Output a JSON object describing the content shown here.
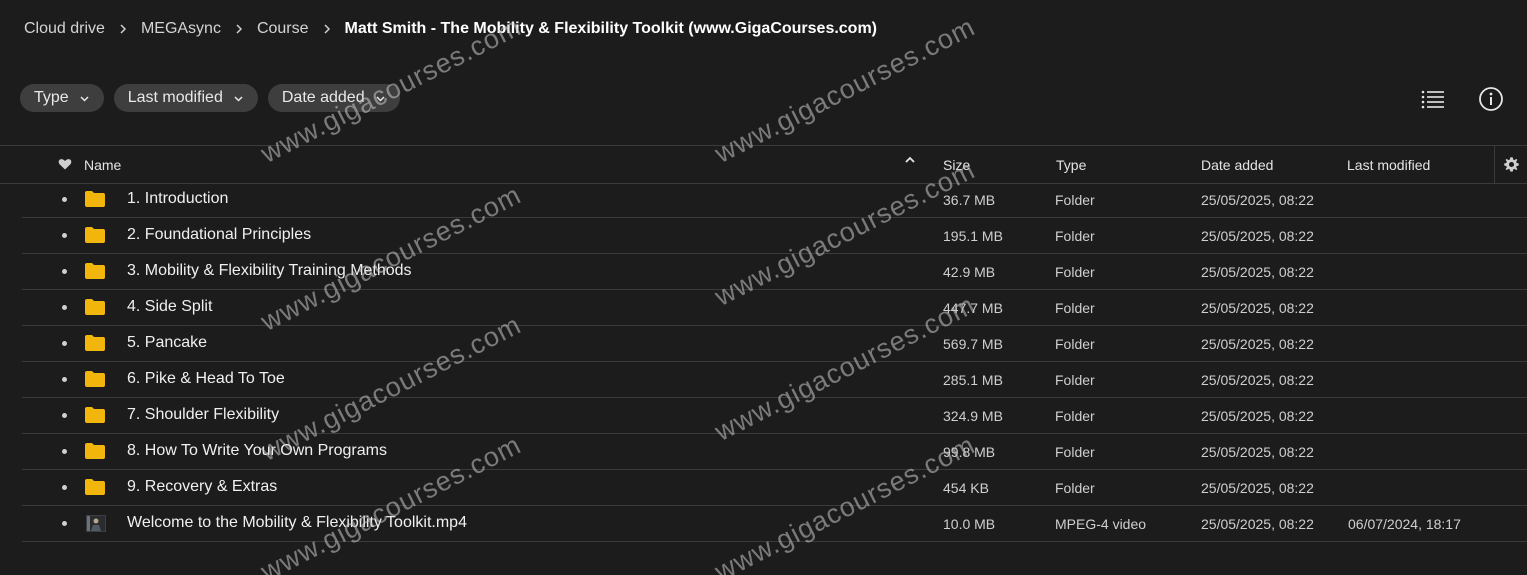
{
  "breadcrumb": {
    "items": [
      "Cloud drive",
      "MEGAsync",
      "Course"
    ],
    "current": "Matt Smith - The Mobility & Flexibility Toolkit (www.GigaCourses.com)"
  },
  "filters": {
    "type": "Type",
    "last_modified": "Last modified",
    "date_added": "Date added"
  },
  "icons": {
    "list_view": "list-view-icon",
    "info": "info-icon",
    "favourite": "heart-icon",
    "settings": "gear-icon",
    "folder": "folder-icon"
  },
  "colors": {
    "background": "#1b1c1b",
    "pill": "#3d3e3d",
    "folder": "#f2b50c",
    "divider": "#3a3b3a"
  },
  "columns": {
    "name": "Name",
    "size": "Size",
    "type": "Type",
    "date_added": "Date added",
    "last_modified": "Last modified"
  },
  "rows": [
    {
      "name": "1. Introduction",
      "size": "36.7 MB",
      "type": "Folder",
      "date_added": "25/05/2025, 08:22",
      "last_modified": ""
    },
    {
      "name": "2. Foundational Principles",
      "size": "195.1 MB",
      "type": "Folder",
      "date_added": "25/05/2025, 08:22",
      "last_modified": ""
    },
    {
      "name": "3. Mobility & Flexibility Training Methods",
      "size": "42.9 MB",
      "type": "Folder",
      "date_added": "25/05/2025, 08:22",
      "last_modified": ""
    },
    {
      "name": "4. Side Split",
      "size": "447.7 MB",
      "type": "Folder",
      "date_added": "25/05/2025, 08:22",
      "last_modified": ""
    },
    {
      "name": "5. Pancake",
      "size": "569.7 MB",
      "type": "Folder",
      "date_added": "25/05/2025, 08:22",
      "last_modified": ""
    },
    {
      "name": "6. Pike & Head To Toe",
      "size": "285.1 MB",
      "type": "Folder",
      "date_added": "25/05/2025, 08:22",
      "last_modified": ""
    },
    {
      "name": "7. Shoulder Flexibility",
      "size": "324.9 MB",
      "type": "Folder",
      "date_added": "25/05/2025, 08:22",
      "last_modified": ""
    },
    {
      "name": "8. How To Write Your Own Programs",
      "size": "99.8 MB",
      "type": "Folder",
      "date_added": "25/05/2025, 08:22",
      "last_modified": ""
    },
    {
      "name": "9. Recovery & Extras",
      "size": "454 KB",
      "type": "Folder",
      "date_added": "25/05/2025, 08:22",
      "last_modified": ""
    },
    {
      "name": "Welcome to the Mobility & Flexibility Toolkit.mp4",
      "size": "10.0 MB",
      "type": "MPEG-4 video",
      "date_added": "25/05/2025, 08:22",
      "last_modified": "06/07/2024, 18:17"
    }
  ],
  "watermark": "www.gigacourses.com"
}
